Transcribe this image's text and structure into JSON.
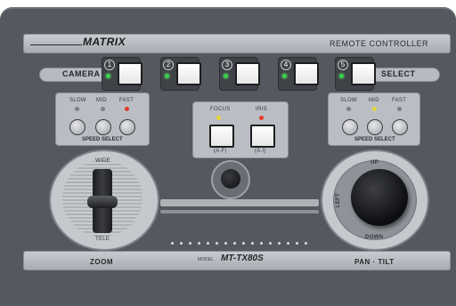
{
  "brand": "MATRIX",
  "remote_title": "REMOTE CONTROLLER",
  "camera_label": "CAMERA",
  "select_label": "SELECT",
  "camera_buttons": [
    {
      "number": "1",
      "led": "green"
    },
    {
      "number": "2",
      "led": "green"
    },
    {
      "number": "3",
      "led": "green"
    },
    {
      "number": "4",
      "led": "green"
    },
    {
      "number": "5",
      "led": "green"
    }
  ],
  "speed_left": {
    "labels": [
      "SLOW",
      "MID",
      "FAST"
    ],
    "caption": "SPEED SELECT"
  },
  "focus_group": {
    "labels": [
      "FOCUS",
      "IRIS"
    ],
    "button_captions": [
      "(A.F)",
      "(A.I)"
    ]
  },
  "speed_right": {
    "labels": [
      "SLOW",
      "MID",
      "FAST"
    ],
    "caption": "SPEED SELECT"
  },
  "zoom_wheel": {
    "top": "WIDE",
    "bottom": "TELE"
  },
  "pantilt": {
    "up": "UP",
    "down": "DOWN",
    "left": "LEFT"
  },
  "bottom": {
    "zoom": "ZOOM",
    "model_prefix": "MODEL",
    "model": "MT-TX80S",
    "pantilt": "PAN · TILT"
  },
  "colors": {
    "panel": "#55585e",
    "strip": "#b7bbc1",
    "led_green": "#37d24a",
    "led_yellow": "#e8d33a",
    "led_red": "#e23a2c"
  }
}
